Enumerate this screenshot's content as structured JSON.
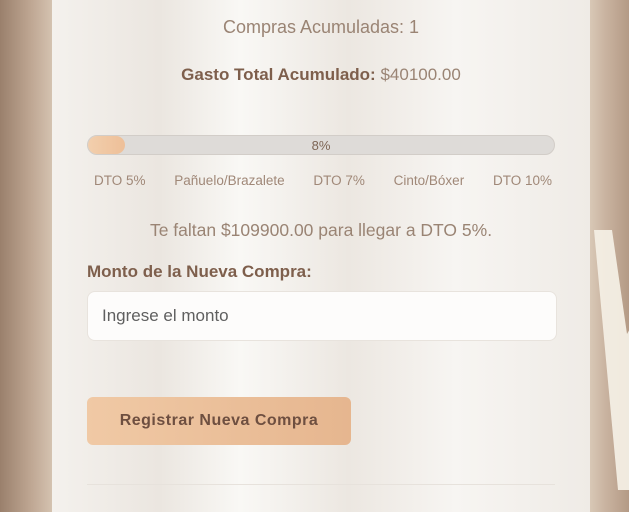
{
  "summary": {
    "purchases_text": "Compras Acumuladas: 1",
    "total_label": "Gasto Total Acumulado:",
    "total_value": "$40100.00"
  },
  "progress": {
    "percent_text": "8%",
    "fill_fraction": 0.08,
    "milestones": [
      "DTO 5%",
      "Pañuelo/Brazalete",
      "DTO 7%",
      "Cinto/Bóxer",
      "DTO 10%"
    ]
  },
  "remaining_text": "Te faltan $109900.00 para llegar a DTO 5%.",
  "form": {
    "amount_label": "Monto de la Nueva Compra:",
    "amount_placeholder": "Ingrese el monto",
    "submit_label": "Registrar Nueva Compra"
  }
}
